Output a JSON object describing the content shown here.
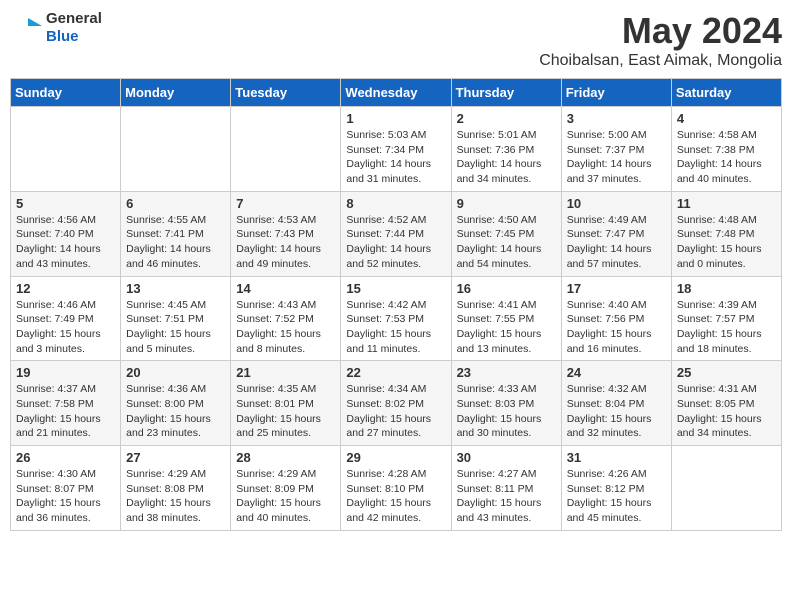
{
  "logo": {
    "general": "General",
    "blue": "Blue"
  },
  "title": "May 2024",
  "subtitle": "Choibalsan, East Aimak, Mongolia",
  "days_of_week": [
    "Sunday",
    "Monday",
    "Tuesday",
    "Wednesday",
    "Thursday",
    "Friday",
    "Saturday"
  ],
  "weeks": [
    [
      {
        "day": "",
        "info": ""
      },
      {
        "day": "",
        "info": ""
      },
      {
        "day": "",
        "info": ""
      },
      {
        "day": "1",
        "info": "Sunrise: 5:03 AM\nSunset: 7:34 PM\nDaylight: 14 hours\nand 31 minutes."
      },
      {
        "day": "2",
        "info": "Sunrise: 5:01 AM\nSunset: 7:36 PM\nDaylight: 14 hours\nand 34 minutes."
      },
      {
        "day": "3",
        "info": "Sunrise: 5:00 AM\nSunset: 7:37 PM\nDaylight: 14 hours\nand 37 minutes."
      },
      {
        "day": "4",
        "info": "Sunrise: 4:58 AM\nSunset: 7:38 PM\nDaylight: 14 hours\nand 40 minutes."
      }
    ],
    [
      {
        "day": "5",
        "info": "Sunrise: 4:56 AM\nSunset: 7:40 PM\nDaylight: 14 hours\nand 43 minutes."
      },
      {
        "day": "6",
        "info": "Sunrise: 4:55 AM\nSunset: 7:41 PM\nDaylight: 14 hours\nand 46 minutes."
      },
      {
        "day": "7",
        "info": "Sunrise: 4:53 AM\nSunset: 7:43 PM\nDaylight: 14 hours\nand 49 minutes."
      },
      {
        "day": "8",
        "info": "Sunrise: 4:52 AM\nSunset: 7:44 PM\nDaylight: 14 hours\nand 52 minutes."
      },
      {
        "day": "9",
        "info": "Sunrise: 4:50 AM\nSunset: 7:45 PM\nDaylight: 14 hours\nand 54 minutes."
      },
      {
        "day": "10",
        "info": "Sunrise: 4:49 AM\nSunset: 7:47 PM\nDaylight: 14 hours\nand 57 minutes."
      },
      {
        "day": "11",
        "info": "Sunrise: 4:48 AM\nSunset: 7:48 PM\nDaylight: 15 hours\nand 0 minutes."
      }
    ],
    [
      {
        "day": "12",
        "info": "Sunrise: 4:46 AM\nSunset: 7:49 PM\nDaylight: 15 hours\nand 3 minutes."
      },
      {
        "day": "13",
        "info": "Sunrise: 4:45 AM\nSunset: 7:51 PM\nDaylight: 15 hours\nand 5 minutes."
      },
      {
        "day": "14",
        "info": "Sunrise: 4:43 AM\nSunset: 7:52 PM\nDaylight: 15 hours\nand 8 minutes."
      },
      {
        "day": "15",
        "info": "Sunrise: 4:42 AM\nSunset: 7:53 PM\nDaylight: 15 hours\nand 11 minutes."
      },
      {
        "day": "16",
        "info": "Sunrise: 4:41 AM\nSunset: 7:55 PM\nDaylight: 15 hours\nand 13 minutes."
      },
      {
        "day": "17",
        "info": "Sunrise: 4:40 AM\nSunset: 7:56 PM\nDaylight: 15 hours\nand 16 minutes."
      },
      {
        "day": "18",
        "info": "Sunrise: 4:39 AM\nSunset: 7:57 PM\nDaylight: 15 hours\nand 18 minutes."
      }
    ],
    [
      {
        "day": "19",
        "info": "Sunrise: 4:37 AM\nSunset: 7:58 PM\nDaylight: 15 hours\nand 21 minutes."
      },
      {
        "day": "20",
        "info": "Sunrise: 4:36 AM\nSunset: 8:00 PM\nDaylight: 15 hours\nand 23 minutes."
      },
      {
        "day": "21",
        "info": "Sunrise: 4:35 AM\nSunset: 8:01 PM\nDaylight: 15 hours\nand 25 minutes."
      },
      {
        "day": "22",
        "info": "Sunrise: 4:34 AM\nSunset: 8:02 PM\nDaylight: 15 hours\nand 27 minutes."
      },
      {
        "day": "23",
        "info": "Sunrise: 4:33 AM\nSunset: 8:03 PM\nDaylight: 15 hours\nand 30 minutes."
      },
      {
        "day": "24",
        "info": "Sunrise: 4:32 AM\nSunset: 8:04 PM\nDaylight: 15 hours\nand 32 minutes."
      },
      {
        "day": "25",
        "info": "Sunrise: 4:31 AM\nSunset: 8:05 PM\nDaylight: 15 hours\nand 34 minutes."
      }
    ],
    [
      {
        "day": "26",
        "info": "Sunrise: 4:30 AM\nSunset: 8:07 PM\nDaylight: 15 hours\nand 36 minutes."
      },
      {
        "day": "27",
        "info": "Sunrise: 4:29 AM\nSunset: 8:08 PM\nDaylight: 15 hours\nand 38 minutes."
      },
      {
        "day": "28",
        "info": "Sunrise: 4:29 AM\nSunset: 8:09 PM\nDaylight: 15 hours\nand 40 minutes."
      },
      {
        "day": "29",
        "info": "Sunrise: 4:28 AM\nSunset: 8:10 PM\nDaylight: 15 hours\nand 42 minutes."
      },
      {
        "day": "30",
        "info": "Sunrise: 4:27 AM\nSunset: 8:11 PM\nDaylight: 15 hours\nand 43 minutes."
      },
      {
        "day": "31",
        "info": "Sunrise: 4:26 AM\nSunset: 8:12 PM\nDaylight: 15 hours\nand 45 minutes."
      },
      {
        "day": "",
        "info": ""
      }
    ]
  ]
}
